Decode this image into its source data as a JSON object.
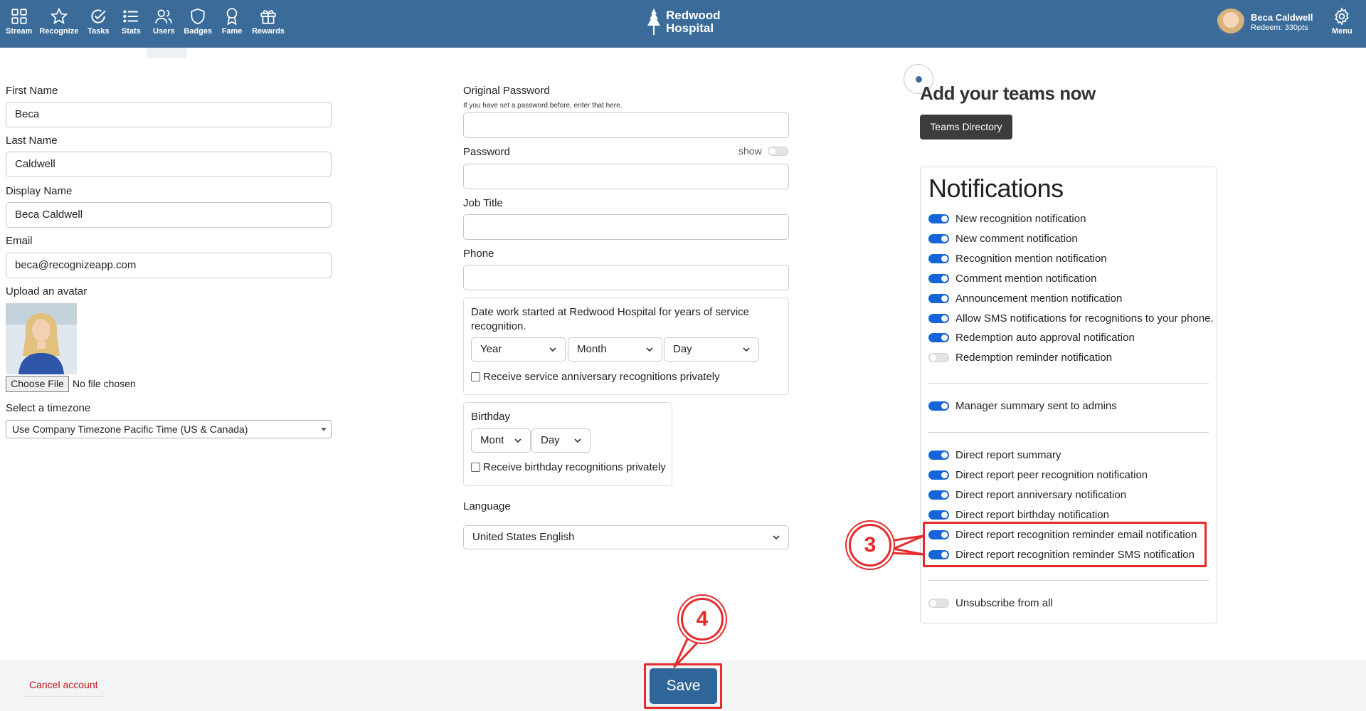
{
  "nav": {
    "items": [
      {
        "label": "Stream",
        "icon": "grid-icon"
      },
      {
        "label": "Recognize",
        "icon": "star-icon"
      },
      {
        "label": "Tasks",
        "icon": "check-circle-icon"
      },
      {
        "label": "Stats",
        "icon": "list-icon"
      },
      {
        "label": "Users",
        "icon": "users-icon"
      },
      {
        "label": "Badges",
        "icon": "shield-icon"
      },
      {
        "label": "Fame",
        "icon": "ribbon-icon"
      },
      {
        "label": "Rewards",
        "icon": "gift-icon"
      }
    ],
    "brand_line1": "Redwood",
    "brand_line2": "Hospital",
    "user_name": "Beca Caldwell",
    "user_points": "Redeem: 330pts",
    "menu_label": "Menu"
  },
  "profile": {
    "first_name_label": "First Name",
    "first_name": "Beca",
    "last_name_label": "Last Name",
    "last_name": "Caldwell",
    "display_name_label": "Display Name",
    "display_name": "Beca Caldwell",
    "email_label": "Email",
    "email": "beca@recognizeapp.com",
    "avatar_label": "Upload an avatar",
    "choose_file": "Choose File",
    "no_file": "No file chosen",
    "timezone_label": "Select a timezone",
    "timezone": "Use Company Timezone Pacific Time (US & Canada)"
  },
  "account": {
    "orig_password_label": "Original Password",
    "orig_password_hint": "If you have set a password before, enter that here.",
    "password_label": "Password",
    "show_label": "show",
    "job_title_label": "Job Title",
    "phone_label": "Phone",
    "work_start_label": "Date work started at Redwood Hospital for years of service recognition.",
    "year": "Year",
    "month": "Month",
    "day": "Day",
    "anniversary_private": "Receive service anniversary recognitions privately",
    "birthday_label": "Birthday",
    "bday_month": "Mont",
    "bday_day": "Day",
    "birthday_private": "Receive birthday recognitions privately",
    "language_label": "Language",
    "language": "United States English"
  },
  "teams": {
    "title": "Add your teams now",
    "button": "Teams Directory"
  },
  "notifications": {
    "title": "Notifications",
    "group1": [
      {
        "label": "New recognition notification",
        "on": true
      },
      {
        "label": "New comment notification",
        "on": true
      },
      {
        "label": "Recognition mention notification",
        "on": true
      },
      {
        "label": "Comment mention notification",
        "on": true
      },
      {
        "label": "Announcement mention notification",
        "on": true
      },
      {
        "label": "Allow SMS notifications for recognitions to your phone.",
        "on": true
      },
      {
        "label": "Redemption auto approval notification",
        "on": true
      },
      {
        "label": "Redemption reminder notification",
        "on": false
      }
    ],
    "group2": [
      {
        "label": "Manager summary sent to admins",
        "on": true
      }
    ],
    "group3": [
      {
        "label": "Direct report summary",
        "on": true
      },
      {
        "label": "Direct report peer recognition notification",
        "on": true
      },
      {
        "label": "Direct report anniversary notification",
        "on": true
      },
      {
        "label": "Direct report birthday notification",
        "on": true
      },
      {
        "label": "Direct report recognition reminder email notification",
        "on": true
      },
      {
        "label": "Direct report recognition reminder SMS notification",
        "on": true
      }
    ],
    "group4": [
      {
        "label": "Unsubscribe from all",
        "on": false
      }
    ]
  },
  "footer": {
    "cancel": "Cancel account",
    "save": "Save"
  },
  "annotations": {
    "step3": "3",
    "step4": "4",
    "color": "#e52b2b"
  },
  "colors": {
    "nav_bg": "#3b6b99",
    "toggle_on": "#1565d8",
    "save_bg": "#2f6598",
    "cancel_text": "#c0161b"
  }
}
